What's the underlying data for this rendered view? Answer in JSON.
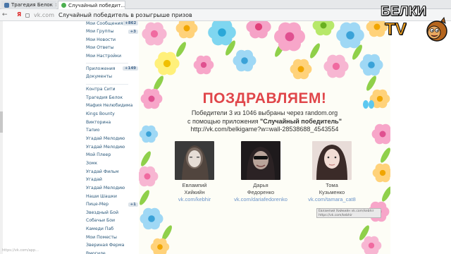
{
  "browser": {
    "tabs": [
      {
        "label": "Трагедия Белок",
        "favicon_color": "#4a76a8"
      },
      {
        "label": "Случайный победит...",
        "favicon_color": "#4caf50"
      }
    ],
    "yandex_glyph": "Я",
    "address": {
      "domain": "vk.com",
      "page_title": "Случайный победитель в розыгрыше призов"
    },
    "status_text": "https://vk.com/app..."
  },
  "sidebar": {
    "items": [
      {
        "label": "Мои Сообщения",
        "badge": "+862"
      },
      {
        "label": "Мои Группы",
        "badge": "+3"
      },
      {
        "label": "Мои Новости",
        "badge": ""
      },
      {
        "label": "Мои Ответы",
        "badge": ""
      },
      {
        "label": "Мои Настройки",
        "badge": ""
      },
      {
        "label": "Приложения",
        "badge": "+149"
      },
      {
        "label": "Документы",
        "badge": ""
      },
      {
        "label": "Контра Сити",
        "badge": ""
      },
      {
        "label": "Трагедия Белок",
        "badge": ""
      },
      {
        "label": "Мафия Нелюбидима",
        "badge": ""
      },
      {
        "label": "Kings Bounty",
        "badge": ""
      },
      {
        "label": "Викторина",
        "badge": ""
      },
      {
        "label": "Тапио",
        "badge": ""
      },
      {
        "label": "Угадай Мелодию",
        "badge": ""
      },
      {
        "label": "Угадай Мелодию",
        "badge": ""
      },
      {
        "label": "Мой Плеер",
        "badge": ""
      },
      {
        "label": "Зомк",
        "badge": ""
      },
      {
        "label": "Угадай Фильм",
        "badge": ""
      },
      {
        "label": "Угадай",
        "badge": ""
      },
      {
        "label": "Угадай Мелодию",
        "badge": ""
      },
      {
        "label": "Наши Шашки",
        "badge": ""
      },
      {
        "label": "Пице-Мер",
        "badge": "+1"
      },
      {
        "label": "Звездный Бой",
        "badge": ""
      },
      {
        "label": "Собачьи Бои",
        "badge": ""
      },
      {
        "label": "Камеди Паб",
        "badge": ""
      },
      {
        "label": "Мои Поместы",
        "badge": ""
      },
      {
        "label": "Звериная Ферма",
        "badge": ""
      },
      {
        "label": "Вмогиле",
        "badge": ""
      }
    ]
  },
  "postcard": {
    "congrats": "ПОЗДРАВЛЯЕМ!",
    "line1": "Победители 3 из 1046 выбраны через random.org",
    "line2_prefix": "с помощью приложения ",
    "line2_app": "\"Случайный победитель\"",
    "line3": "http://vk.com/belkigame?w=wall-28538688_4543554",
    "winners": [
      {
        "first_name": "Евлампий",
        "last_name": "Хийкийн",
        "link": "vk.com/kebhir"
      },
      {
        "first_name": "Дарья",
        "last_name": "Федоренко",
        "link": "vk.com/dariafedorenko"
      },
      {
        "first_name": "Тома",
        "last_name": "Кузьменко",
        "link": "vk.com/tamara_cat8"
      }
    ],
    "tooltip": "Евлампий Хийкийн vk.com/kebhir https://vk.com/kebhir"
  },
  "logo": {
    "line1": "БЕЛКИ",
    "line2": "TV"
  },
  "colors": {
    "congrats": "#e0464a",
    "link": "#6a93c8",
    "vk_menu": "#2b587a"
  }
}
